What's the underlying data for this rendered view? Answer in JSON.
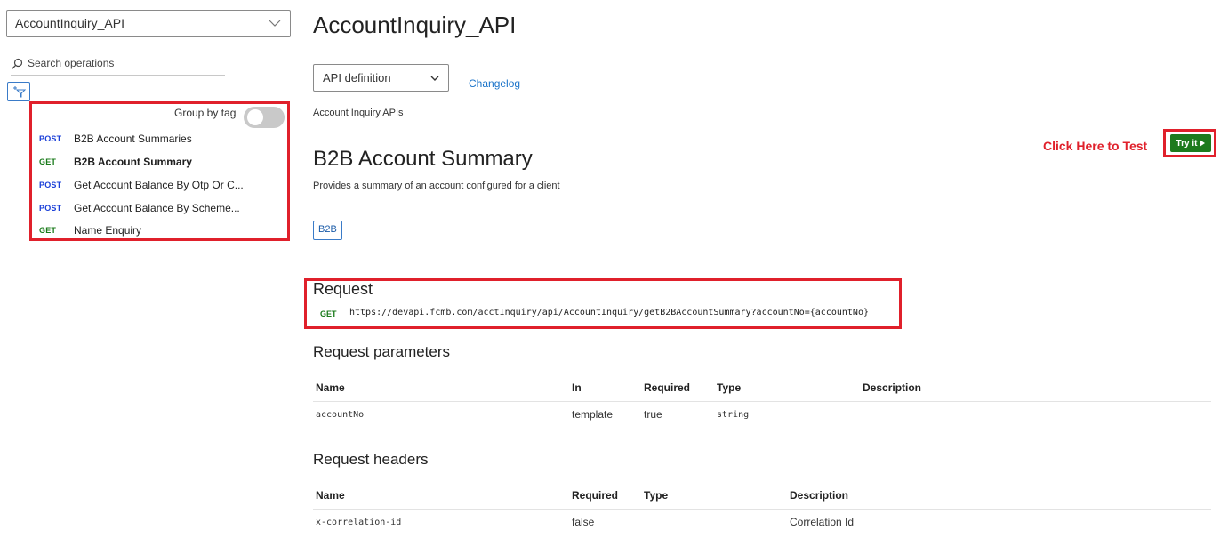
{
  "sidebar": {
    "api_selected": "AccountInquiry_API",
    "search_placeholder": "Search operations",
    "group_by_tag_label": "Group by tag",
    "operations": [
      {
        "method": "POST",
        "name": "B2B Account Summaries"
      },
      {
        "method": "GET",
        "name": "B2B Account Summary"
      },
      {
        "method": "POST",
        "name": "Get Account Balance By Otp Or C..."
      },
      {
        "method": "POST",
        "name": "Get Account Balance By Scheme..."
      },
      {
        "method": "GET",
        "name": "Name Enquiry"
      }
    ]
  },
  "main": {
    "api_title": "AccountInquiry_API",
    "definition_select": "API definition",
    "changelog_label": "Changelog",
    "api_description": "Account Inquiry APIs",
    "operation_title": "B2B Account Summary",
    "operation_description": "Provides a summary of an account configured for a client",
    "tag": "B2B",
    "callout": "Click Here to Test",
    "try_label": "Try it",
    "request": {
      "title": "Request",
      "method": "GET",
      "url": "https://devapi.fcmb.com/acctInquiry/api/AccountInquiry/getB2BAccountSummary?accountNo={accountNo}"
    },
    "request_parameters": {
      "title": "Request parameters",
      "headers": [
        "Name",
        "In",
        "Required",
        "Type",
        "Description"
      ],
      "rows": [
        [
          "accountNo",
          "template",
          "true",
          "string",
          ""
        ]
      ]
    },
    "request_headers": {
      "title": "Request headers",
      "headers": [
        "Name",
        "Required",
        "Type",
        "Description"
      ],
      "rows": [
        [
          "x-correlation-id",
          "false",
          "",
          "Correlation Id"
        ]
      ]
    }
  },
  "colors": {
    "highlight": "#e0202b",
    "post": "#1a3fd8",
    "get": "#187a19",
    "link": "#1a73c9",
    "try_button": "#1d7a1d"
  }
}
